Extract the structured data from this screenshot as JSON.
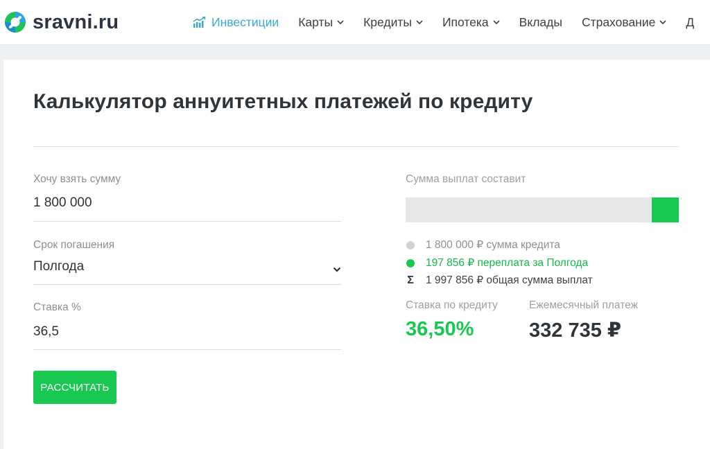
{
  "header": {
    "brand": "sravni.ru",
    "nav": [
      {
        "label": "Инвестиции",
        "active": true,
        "icon": "chart-growth-icon"
      },
      {
        "label": "Карты",
        "dropdown": true
      },
      {
        "label": "Кредиты",
        "dropdown": true
      },
      {
        "label": "Ипотека",
        "dropdown": true
      },
      {
        "label": "Вклады",
        "dropdown": false
      },
      {
        "label": "Страхование",
        "dropdown": true
      },
      {
        "label": "Д",
        "dropdown": false
      }
    ]
  },
  "calculator": {
    "title": "Калькулятор аннуитетных платежей по кредиту",
    "amount": {
      "label": "Хочу взять сумму",
      "value": "1 800 000"
    },
    "term": {
      "label": "Срок погашения",
      "value": "Полгода"
    },
    "rate": {
      "label": "Ставка %",
      "value": "36,5"
    },
    "submit_label": "РАССЧИТАТЬ"
  },
  "results": {
    "label": "Сумма выплат составит",
    "overpayment_fraction": 0.099,
    "legend": {
      "principal": "1 800 000 ₽ сумма кредита",
      "overpayment": "197 856 ₽ переплата за Полгода",
      "sigma": "Σ",
      "total": "1 997 856 ₽ общая сумма выплат"
    },
    "rate_label": "Ставка по кредиту",
    "rate_value": "36,50%",
    "monthly_label": "Ежемесячный платеж",
    "monthly_value": "332 735 ₽"
  },
  "colors": {
    "accent_green": "#19c853",
    "nav_active": "#3aa8d8",
    "bar_bg": "#e6e7e8"
  }
}
